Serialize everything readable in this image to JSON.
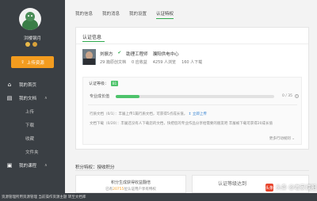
{
  "sidebar": {
    "username": "洪楼钢月",
    "upload_label": "上传资源",
    "nav": [
      {
        "label": "我的首页",
        "icon": "home-icon"
      },
      {
        "label": "我的文档",
        "icon": "document-icon"
      }
    ],
    "sub_items": [
      "上传",
      "下载",
      "收藏",
      "文件夹"
    ],
    "nav_more": {
      "label": "我的课程",
      "icon": "course-icon"
    }
  },
  "topnav": {
    "tabs": [
      "我的信息",
      "我的消息",
      "我的设置",
      "认证特权"
    ],
    "active": "认证特权"
  },
  "auth": {
    "section_title": "认证信息",
    "name": "刘振方",
    "verified_icon": "verified-icon",
    "title": "助理工程师",
    "org": "濮阳供电中心",
    "stats": [
      "29 篇原创文档",
      "0 应收益",
      "4259 人浏览",
      "160 人下载"
    ],
    "level_label": "认证等级：",
    "level_value": "B1",
    "growth_label": "专业成长值",
    "growth_fraction": 0.15,
    "growth_count": "0 / 35",
    "line1_prefix": "行质文档（0/1）：丰屡上传1篇行质文档，可获得",
    "line1_points": "5",
    "line1_mid": "点成长值，",
    "line1_link": "立即上传",
    "line2": "文档下载（0/20）：丰屡还没有人下载您的文档，快把您的专业作品分享给需要的朋友吧 丰屡被下载可获得20成长值",
    "more_link": "更多行动规则"
  },
  "points": {
    "title": "积分特权：授收积分",
    "box1_title": "积分生成获得收益翻倍",
    "box1_sub_prefix": "已有",
    "box1_sub_num": "20755",
    "box1_sub_suffix": "位认证用户享有特权",
    "box2_title": "认证等级达到"
  },
  "watermark": {
    "logo": "头条",
    "text": "头条 @老家濮阳"
  },
  "status_bar": "资源管理所用资源管理 当前操作资源主题 转至文档库"
}
